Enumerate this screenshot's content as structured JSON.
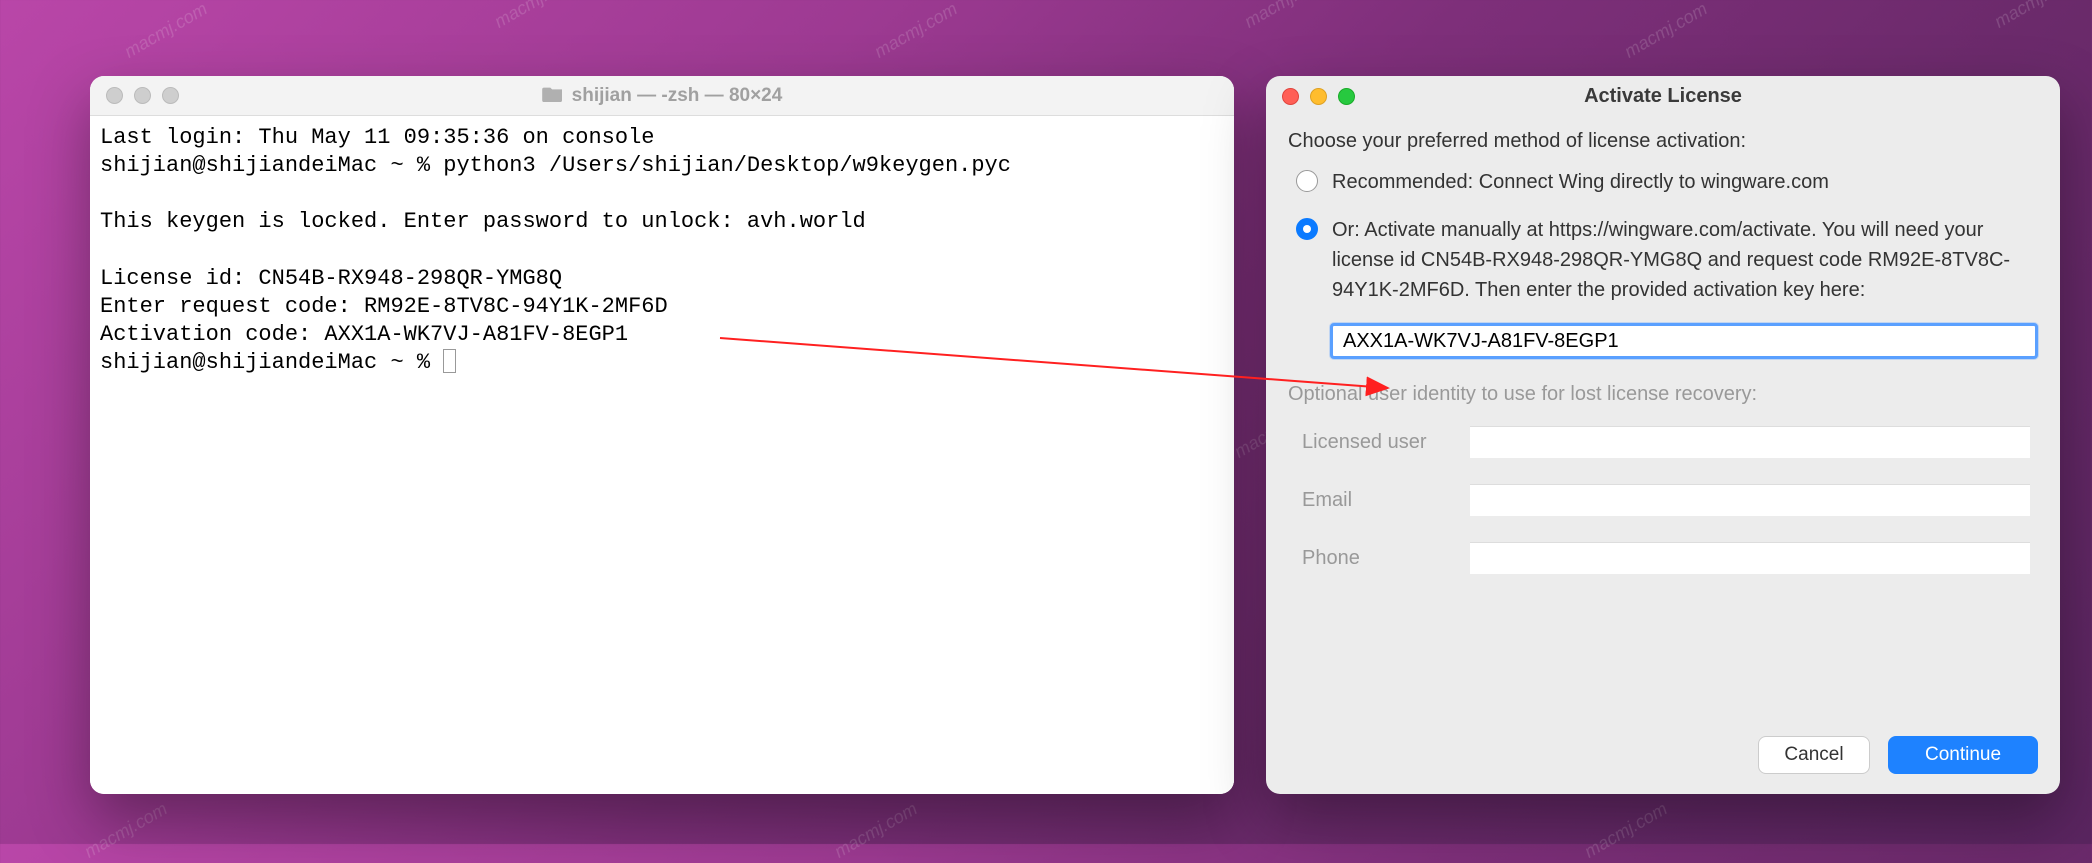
{
  "terminal": {
    "title": "shijian — -zsh — 80×24",
    "lines": {
      "l1": "Last login: Thu May 11 09:35:36 on console",
      "l2": "shijian@shijiandeiMac ~ % python3 /Users/shijian/Desktop/w9keygen.pyc",
      "l3": "",
      "l4": "This keygen is locked. Enter password to unlock: avh.world",
      "l5": "",
      "l6": "License id: CN54B-RX948-298QR-YMG8Q",
      "l7": "Enter request code: RM92E-8TV8C-94Y1K-2MF6D",
      "l8": "Activation code: AXX1A-WK7VJ-A81FV-8EGP1",
      "l9": "shijian@shijiandeiMac ~ % "
    }
  },
  "dialog": {
    "title": "Activate License",
    "choose": "Choose your preferred method of license activation:",
    "option1": "Recommended: Connect Wing directly to wingware.com",
    "option2": "Or:  Activate manually at https://wingware.com/activate. You will need your license id CN54B-RX948-298QR-YMG8Q and request code RM92E-8TV8C-94Y1K-2MF6D. Then enter the provided activation key here:",
    "activation_value": "AXX1A-WK7VJ-A81FV-8EGP1",
    "optional": "Optional user identity to use for lost license recovery:",
    "field_user": "Licensed user",
    "field_email": "Email",
    "field_phone": "Phone",
    "btn_cancel": "Cancel",
    "btn_continue": "Continue"
  },
  "watermark_text": "macmj.com"
}
